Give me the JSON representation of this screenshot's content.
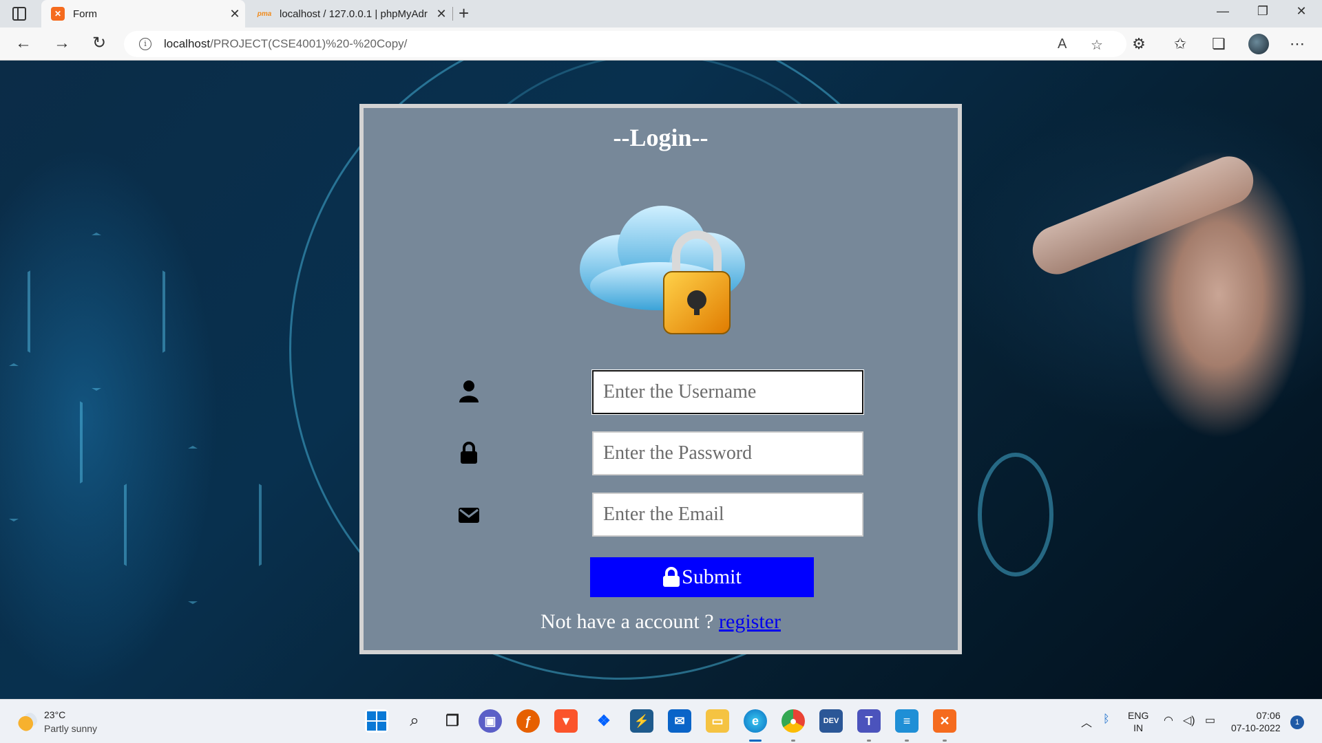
{
  "browser": {
    "tabs": [
      {
        "title": "Form",
        "favicon": "xampp-icon",
        "active": true
      },
      {
        "title": "localhost / 127.0.0.1 | phpMyAdr",
        "favicon": "phpmyadmin-icon",
        "active": false
      }
    ],
    "url_host": "localhost",
    "url_path": "/PROJECT(CSE4001)%20-%20Copy/"
  },
  "login": {
    "title": "--Login--",
    "username_placeholder": "Enter the Username",
    "password_placeholder": "Enter the Password",
    "email_placeholder": "Enter the Email",
    "submit_label": "Submit",
    "register_prompt": "Not have a account ? ",
    "register_link": "register",
    "colors": {
      "panel": "#778899",
      "submit": "#0000ff",
      "link": "#0000ee"
    }
  },
  "taskbar": {
    "weather_temp": "23°C",
    "weather_desc": "Partly sunny",
    "lang_top": "ENG",
    "lang_bottom": "IN",
    "time": "07:06",
    "date": "07-10-2022",
    "notifications": "1"
  }
}
